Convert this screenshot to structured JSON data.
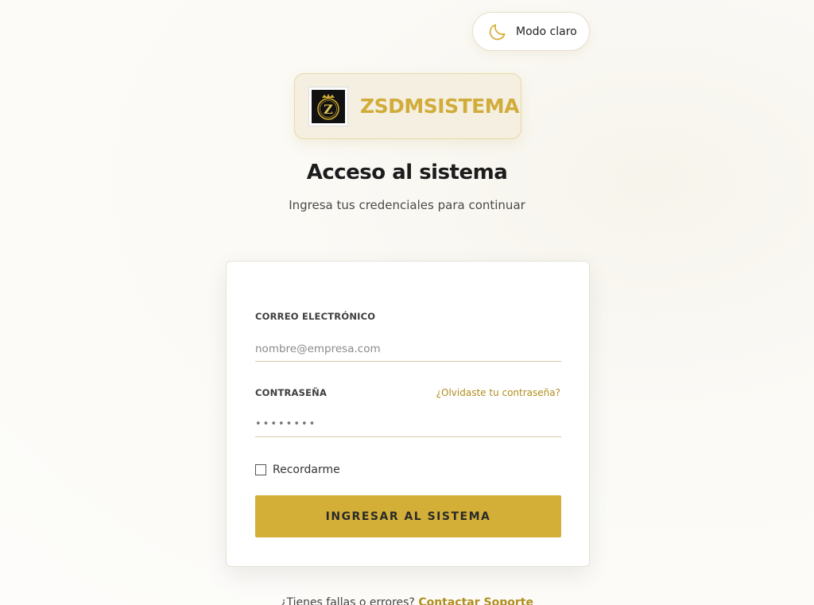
{
  "theme_toggle": {
    "label": "Modo claro",
    "icon": "moon-icon"
  },
  "brand": {
    "name": "ZSDMSISTEMA",
    "logo_letter": "Z"
  },
  "header": {
    "title": "Acceso al sistema",
    "subtitle": "Ingresa tus credenciales para continuar"
  },
  "form": {
    "email_label": "CORREO ELECTRÓNICO",
    "email_placeholder": "nombre@empresa.com",
    "email_value": "",
    "password_label": "CONTRASEÑA",
    "password_mask": "••••••••",
    "forgot_link": "¿Olvidaste tu contraseña?",
    "remember_label": "Recordarme",
    "remember_checked": false,
    "submit_label": "INGRESAR AL SISTEMA"
  },
  "footer": {
    "support_prompt": "¿Tienes fallas o errores?",
    "support_link": "Contactar Soporte"
  },
  "colors": {
    "accent": "#d4af37",
    "link": "#b08e1e"
  }
}
